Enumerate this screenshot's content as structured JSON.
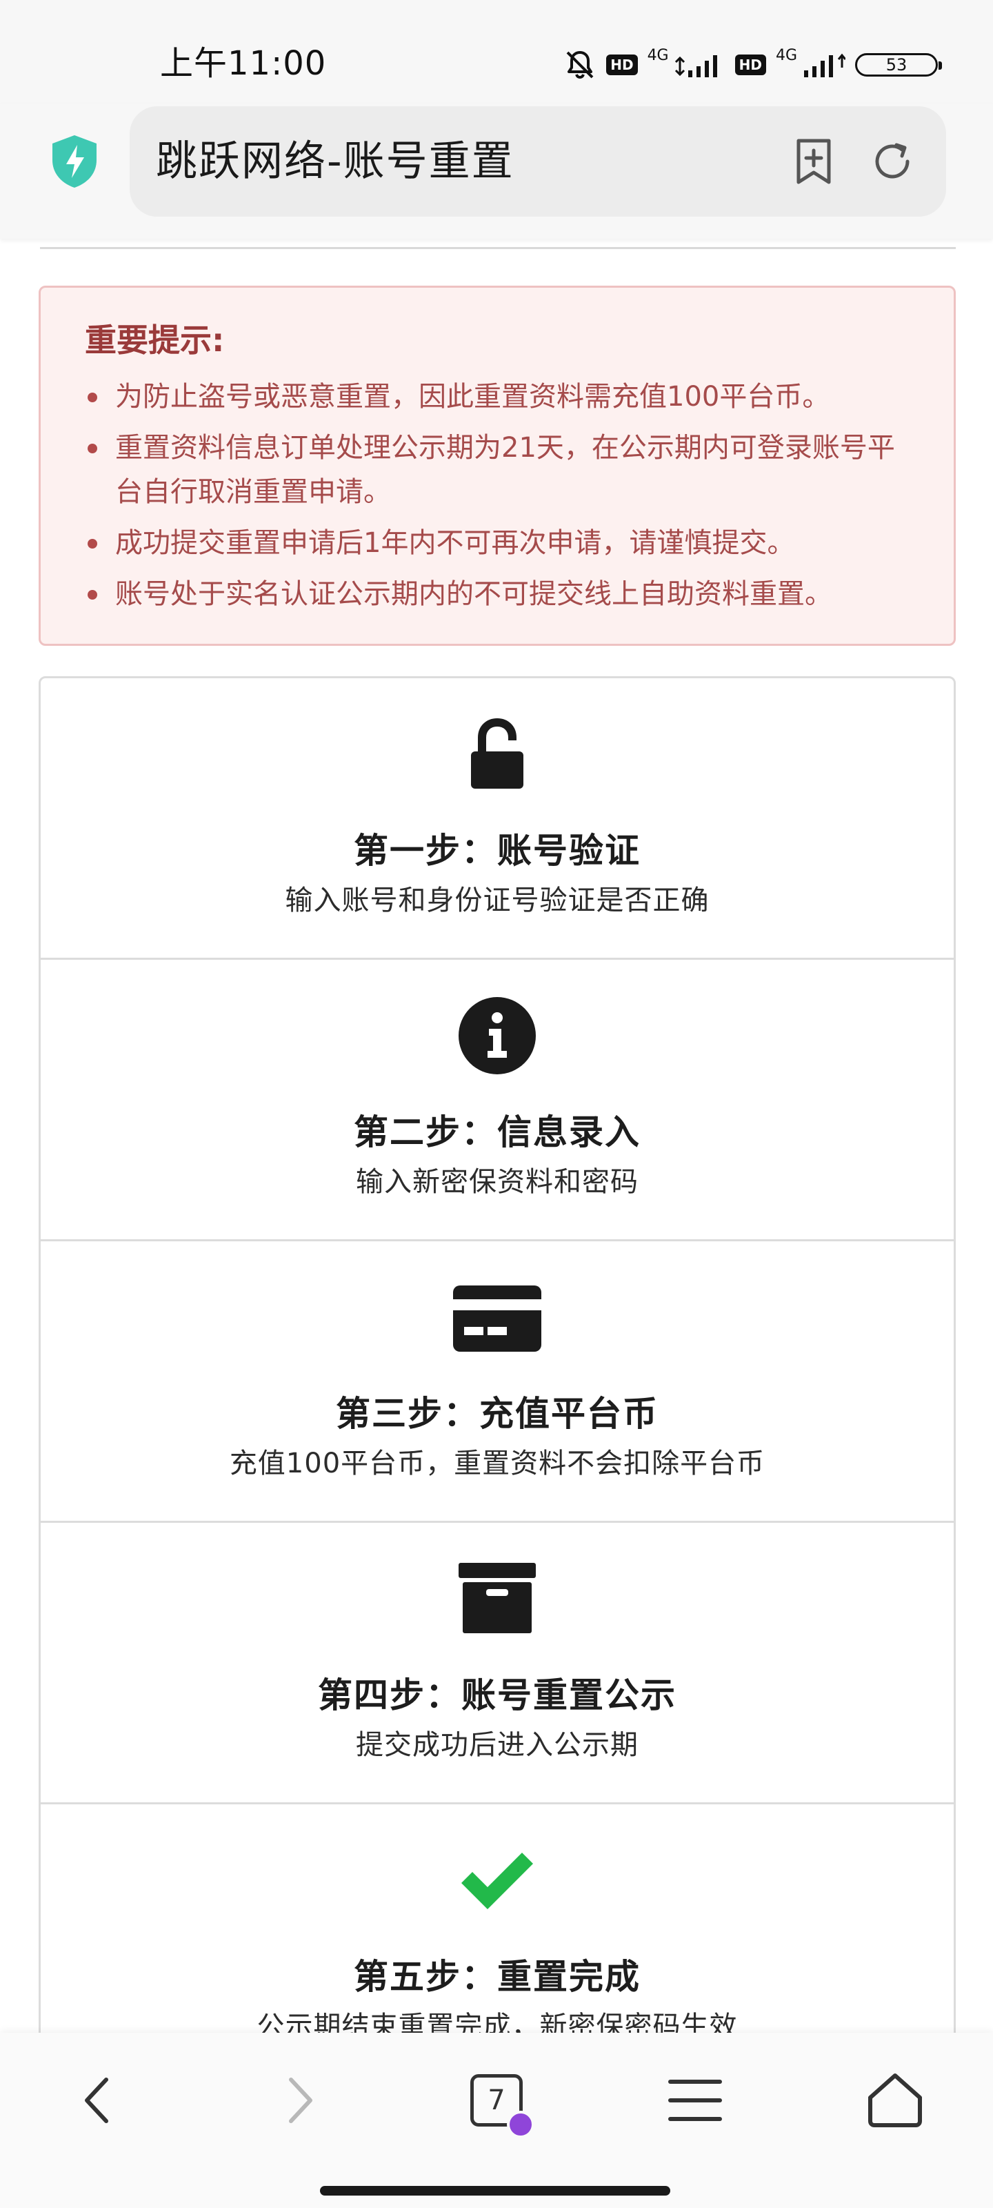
{
  "status_bar": {
    "time": "上午11:00",
    "hd_badge_1": "HD",
    "network_1": "4G",
    "hd_badge_2": "HD",
    "network_2": "4G",
    "battery_level": "53"
  },
  "browser": {
    "page_title": "跳跃网络-账号重置",
    "shield_color": "#3ec8b2",
    "icons": [
      "shield-bolt-icon",
      "bookmark-add-icon",
      "reload-icon"
    ]
  },
  "alert": {
    "title": "重要提示:",
    "items": [
      "为防止盗号或恶意重置，因此重置资料需充值100平台币。",
      "重置资料信息订单处理公示期为21天，在公示期内可登录账号平台自行取消重置申请。",
      "成功提交重置申请后1年内不可再次申请，请谨慎提交。",
      "账号处于实名认证公示期内的不可提交线上自助资料重置。"
    ],
    "colors": {
      "background": "#fdf1f0",
      "border": "#eec2c2",
      "text": "#a54b4b"
    }
  },
  "steps": [
    {
      "icon": "unlock-icon",
      "title": "第一步：账号验证",
      "description": "输入账号和身份证号验证是否正确"
    },
    {
      "icon": "info-icon",
      "title": "第二步：信息录入",
      "description": "输入新密保资料和密码"
    },
    {
      "icon": "credit-card-icon",
      "title": "第三步：充值平台币",
      "description": "充值100平台币，重置资料不会扣除平台币"
    },
    {
      "icon": "archive-box-icon",
      "title": "第四步：账号重置公示",
      "description": "提交成功后进入公示期"
    },
    {
      "icon": "check-icon",
      "title": "第五步：重置完成",
      "description": "公示期结束重置完成，新密保密码生效",
      "icon_color": "#22b94a"
    }
  ],
  "bottom_nav": {
    "tab_count": "7",
    "tab_badge_color": "#8f45d9",
    "icons": [
      "back-arrow-icon",
      "forward-arrow-icon",
      "tabs-icon",
      "menu-icon",
      "home-icon"
    ]
  }
}
